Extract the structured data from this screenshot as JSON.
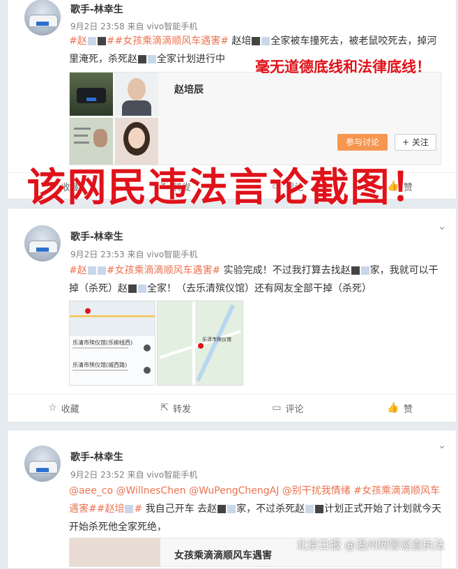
{
  "posts": [
    {
      "user": "歌手-林幸生",
      "time": "9月2日 23:58",
      "source": "来自 vivo智能手机",
      "text_pre": "#赵",
      "text_tag": "##女孩乘滴滴顺风车遇害#",
      "text_body1": " 赵培",
      "text_body2": "全家被车撞死去，被老鼠咬死去，掉河里淹死，杀死赵",
      "text_body3": "全家计划进行中",
      "linked_name": "赵培辰",
      "join_btn": "参与讨论",
      "follow_btn": "+ 关注"
    },
    {
      "user": "歌手-林幸生",
      "time": "9月2日 23:53",
      "source": "来自 vivo智能手机",
      "text_pre": "#赵",
      "text_tag": "#女孩乘滴滴顺风车遇害#",
      "text_body1": " 实验完成！不过我打算去找赵",
      "text_body2": "家，我就可以干掉（杀死）赵",
      "text_body3": "全家！（去乐清殡仪馆）还有网友全部干掉（杀死）"
    },
    {
      "user": "歌手-林幸生",
      "time": "9月2日 23:52",
      "source": "来自 vivo智能手机",
      "mentions": "@aee_co @WillnesChen @WuPengChengAJ @别干扰我情绪",
      "tag_a": "#女孩乘滴滴顺风车遇害##赵培",
      "text_body1": " 我自己开车 去赵",
      "text_body2": "家，不过杀死赵",
      "text_body3": "计划正式开始了计划就今天开始杀死他全家死绝，",
      "linked_title": "女孩乘滴滴顺风车遇害"
    }
  ],
  "actions": {
    "fav": "收藏",
    "repost": "转发",
    "comment": "评论",
    "like": "赞"
  },
  "annotations": {
    "red_small": "毫无道德底线和法律底线！",
    "red_big": "该网民违法言论截图！"
  },
  "map": {
    "addr1_title": "乐清市殡仪馆(乐柳线西)",
    "addr2_title": "乐清市殡仪馆(城西路)",
    "map_label": "乐清市殡仪馆"
  },
  "watermark": "北京日报 @温州网警巡查执法",
  "colors": {
    "tag": "#eb7350",
    "red_overlay": "#e0121a",
    "join_btn": "#f7964f"
  }
}
